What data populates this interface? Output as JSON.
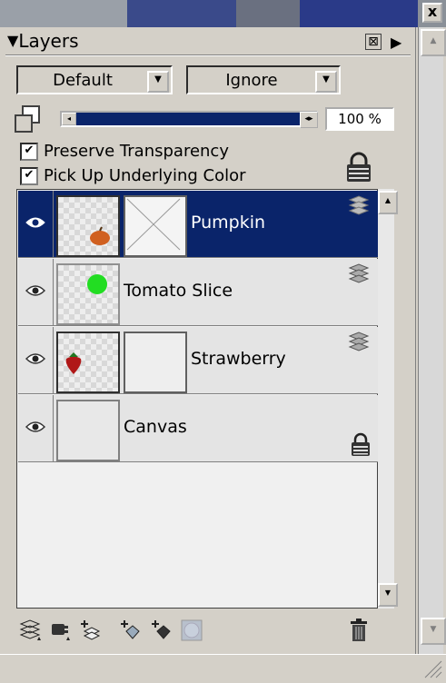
{
  "window": {
    "close_label": "x"
  },
  "panel": {
    "title": "Layers",
    "collapse_glyph": "▼",
    "header_close_glyph": "⊠",
    "options_glyph": "▶"
  },
  "blend_mode": {
    "value": "Default"
  },
  "ignore_mode": {
    "value": "Ignore"
  },
  "opacity": {
    "value": 1.0,
    "label": "100 %"
  },
  "checkboxes": [
    {
      "label": "Preserve Transparency",
      "checked": true
    },
    {
      "label": "Pick Up Underlying Color",
      "checked": true
    }
  ],
  "layers": [
    {
      "name": "Pumpkin",
      "selected": true,
      "visible": true,
      "thumb_icon": "pumpkin-icon",
      "has_mask": true,
      "mask_style": "crossed",
      "icon": "layer-stack-icon"
    },
    {
      "name": "Tomato Slice",
      "selected": false,
      "visible": true,
      "thumb_icon": "green-dot-icon",
      "has_mask": false,
      "icon": "layer-stack-icon"
    },
    {
      "name": "Strawberry",
      "selected": false,
      "visible": true,
      "thumb_icon": "strawberry-icon",
      "has_mask": true,
      "mask_style": "plain",
      "icon": "layer-stack-icon"
    },
    {
      "name": "Canvas",
      "selected": false,
      "visible": true,
      "thumb_icon": "none",
      "has_mask": false,
      "icon": "lock-icon"
    }
  ],
  "toolbar": [
    "layer-properties-icon",
    "new-dynamic-layer-icon",
    "new-layer-icon",
    "new-shape-layer-icon",
    "merge-layers-icon",
    "layer-effect-icon",
    "trash-icon"
  ],
  "colors": {
    "selection": "#0a246a",
    "panel": "#d4d0c8",
    "tomato": "#22dd22",
    "pumpkin": "#d06020",
    "strawberry": "#b01818"
  }
}
